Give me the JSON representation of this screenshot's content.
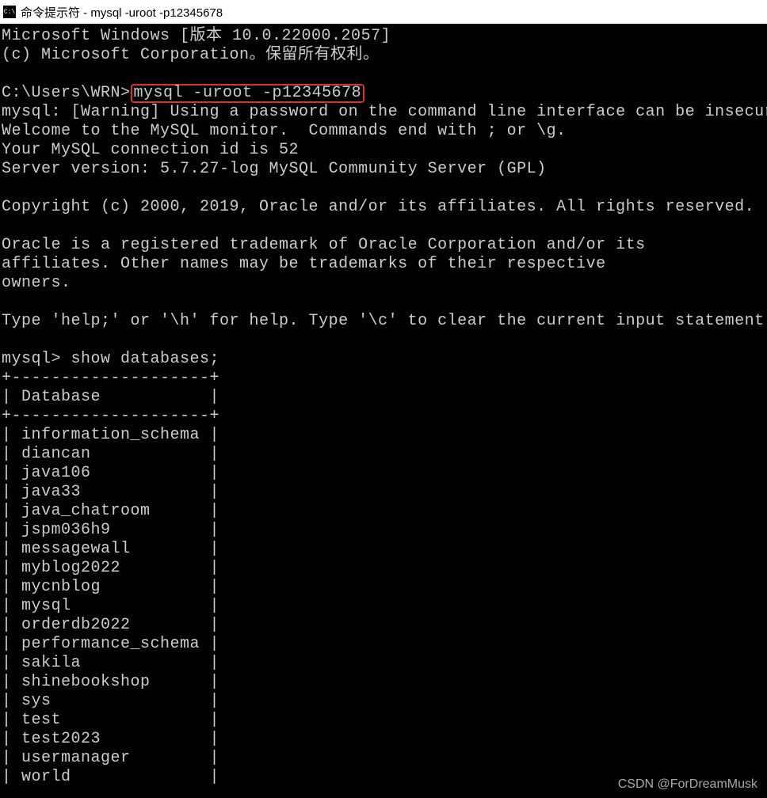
{
  "titlebar": {
    "icon_label": "C:\\",
    "title": "命令提示符 - mysql  -uroot -p12345678"
  },
  "terminal": {
    "line_win_version": "Microsoft Windows [版本 10.0.22000.2057]",
    "line_copyright": "(c) Microsoft Corporation。保留所有权利。",
    "prompt_path": "C:\\Users\\WRN>",
    "highlighted_cmd": "mysql -uroot -p12345678",
    "warning": "mysql: [Warning] Using a password on the command line interface can be insecure.",
    "welcome": "Welcome to the MySQL monitor.  Commands end with ; or \\g.",
    "conn_id": "Your MySQL connection id is 52",
    "server_version": "Server version: 5.7.27-log MySQL Community Server (GPL)",
    "oracle_copyright": "Copyright (c) 2000, 2019, Oracle and/or its affiliates. All rights reserved.",
    "oracle_tm1": "Oracle is a registered trademark of Oracle Corporation and/or its",
    "oracle_tm2": "affiliates. Other names may be trademarks of their respective",
    "oracle_tm3": "owners.",
    "help_line": "Type 'help;' or '\\h' for help. Type '\\c' to clear the current input statement.",
    "mysql_prompt": "mysql> ",
    "show_cmd": "show databases;",
    "table_border": "+--------------------+",
    "table_header": "| Database           |",
    "databases": [
      "information_schema",
      "diancan",
      "java106",
      "java33",
      "java_chatroom",
      "jspm036h9",
      "messagewall",
      "myblog2022",
      "mycnblog",
      "mysql",
      "orderdb2022",
      "performance_schema",
      "sakila",
      "shinebookshop",
      "sys",
      "test",
      "test2023",
      "usermanager",
      "world"
    ]
  },
  "watermark": "CSDN @ForDreamMusk"
}
